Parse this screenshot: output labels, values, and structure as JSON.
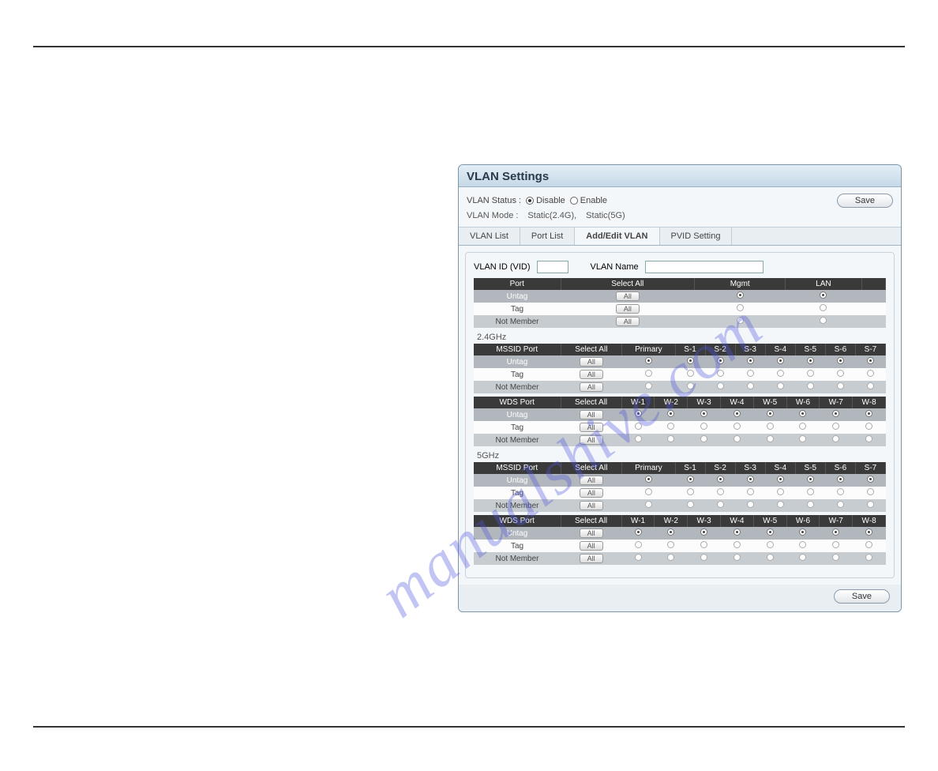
{
  "panel": {
    "title": "VLAN Settings",
    "status_label": "VLAN Status :",
    "disable": "Disable",
    "enable": "Enable",
    "mode_label": "VLAN Mode :",
    "mode_24": "Static(2.4G),",
    "mode_5": "Static(5G)",
    "save": "Save"
  },
  "tabs": {
    "list": "VLAN List",
    "port": "Port List",
    "add": "Add/Edit VLAN",
    "pvid": "PVID Setting"
  },
  "form": {
    "vid_label": "VLAN ID (VID)",
    "name_label": "VLAN Name"
  },
  "hdr": {
    "port": "Port",
    "select_all": "Select All",
    "mgmt": "Mgmt",
    "lan": "LAN",
    "mssid": "MSSID Port",
    "wds": "WDS Port",
    "primary": "Primary",
    "s1": "S-1",
    "s2": "S-2",
    "s3": "S-3",
    "s4": "S-4",
    "s5": "S-5",
    "s6": "S-6",
    "s7": "S-7",
    "w1": "W-1",
    "w2": "W-2",
    "w3": "W-3",
    "w4": "W-4",
    "w5": "W-5",
    "w6": "W-6",
    "w7": "W-7",
    "w8": "W-8"
  },
  "rows": {
    "untag": "Untag",
    "tag": "Tag",
    "notmember": "Not Member",
    "all": "All"
  },
  "bands": {
    "b24": "2.4GHz",
    "b5": "5GHz"
  },
  "watermark": "manualshive.com"
}
